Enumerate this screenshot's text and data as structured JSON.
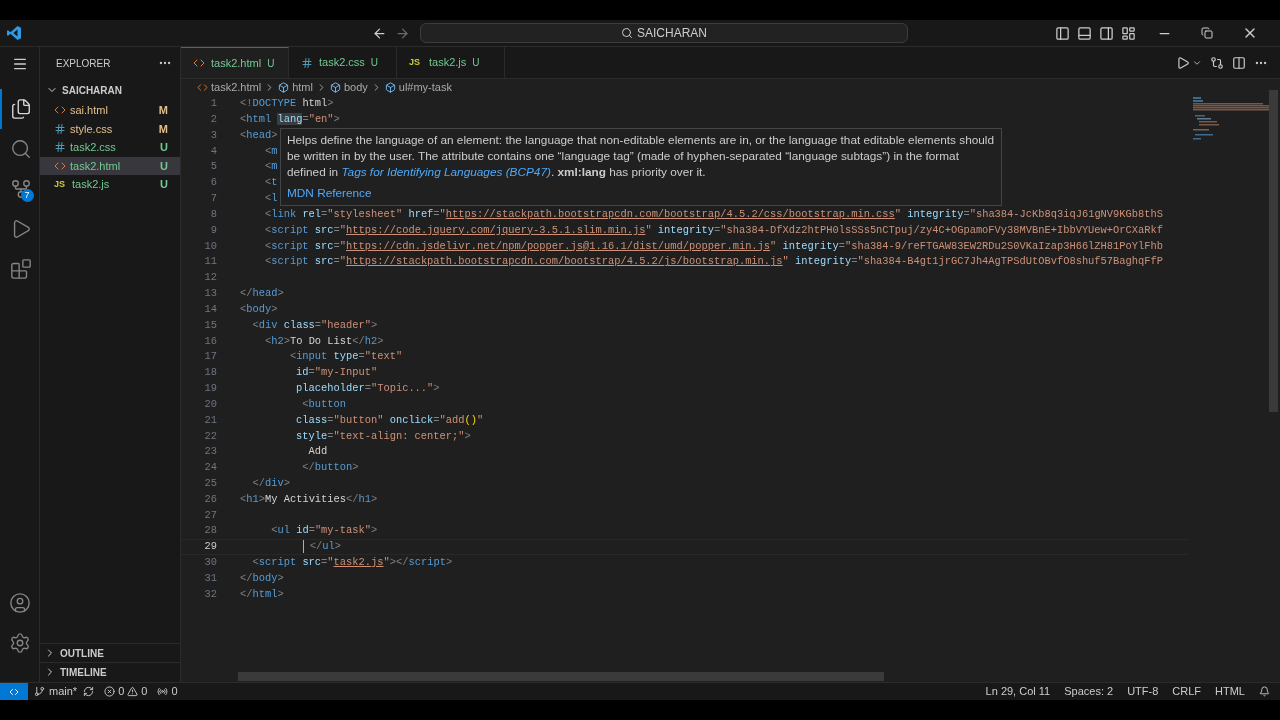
{
  "title_bar": {
    "search_text": "SAICHARAN"
  },
  "activity_bar": [
    {
      "kind": "explorer",
      "selected": true
    },
    {
      "kind": "search",
      "selected": false
    },
    {
      "kind": "source_control",
      "selected": false,
      "badge": "7"
    },
    {
      "kind": "run",
      "selected": false
    },
    {
      "kind": "extensions",
      "selected": false
    }
  ],
  "explorer": {
    "title": "EXPLORER",
    "folder": {
      "name": "SAICHARAN",
      "expanded": true,
      "children": [
        {
          "name": "sai.html",
          "kind": "html",
          "status": "M",
          "color": "#e2c08d",
          "selected": false
        },
        {
          "name": "style.css",
          "kind": "css",
          "status": "M",
          "color": "#e2c08d",
          "selected": false
        },
        {
          "name": "task2.css",
          "kind": "css",
          "status": "U",
          "color": "#73c991",
          "selected": false
        },
        {
          "name": "task2.html",
          "kind": "html",
          "status": "U",
          "color": "#73c991",
          "selected": true
        },
        {
          "name": "task2.js",
          "kind": "js",
          "icon_label": "JS",
          "status": "U",
          "color": "#73c991",
          "selected": false
        }
      ]
    },
    "sections": [
      {
        "label": "OUTLINE",
        "expanded": false
      },
      {
        "label": "TIMELINE",
        "expanded": false
      }
    ]
  },
  "tabs": [
    {
      "label": "task2.html",
      "kind": "html",
      "status": "U",
      "color": "#73c991",
      "selected": true
    },
    {
      "label": "task2.css",
      "kind": "css",
      "status": "U",
      "color": "#73c991",
      "selected": false
    },
    {
      "label": "task2.js",
      "kind": "js",
      "icon_label": "JS",
      "status": "U",
      "color": "#73c991",
      "selected": false
    }
  ],
  "breadcrumb": [
    {
      "label": "task2.html",
      "kind": "file"
    },
    {
      "label": "html",
      "kind": "element"
    },
    {
      "label": "body",
      "kind": "element"
    },
    {
      "label": "ul#my-task",
      "kind": "element"
    }
  ],
  "editor": {
    "lines": [
      {
        "number": "1",
        "active": false,
        "tokens": [
          {
            "kind": "punct",
            "text": "<!"
          },
          {
            "kind": "tag",
            "text": "DOCTYPE"
          },
          {
            "kind": "plain",
            "text": " html"
          },
          {
            "kind": "punct",
            "text": ">"
          }
        ]
      },
      {
        "number": "2",
        "active": false,
        "tokens": [
          {
            "kind": "punct",
            "text": "<"
          },
          {
            "kind": "tag",
            "text": "html "
          },
          {
            "kind": "attr",
            "text": "lang",
            "highlighted": true
          },
          {
            "kind": "punct",
            "text": "="
          },
          {
            "kind": "string",
            "text": "\"en\""
          },
          {
            "kind": "punct",
            "text": ">"
          }
        ]
      },
      {
        "number": "3",
        "active": false,
        "tokens": [
          {
            "kind": "punct",
            "text": "<"
          },
          {
            "kind": "tag",
            "text": "head"
          },
          {
            "kind": "punct",
            "text": ">"
          }
        ]
      },
      {
        "number": "4",
        "active": false,
        "tokens": [
          {
            "kind": "punct",
            "text": "    <"
          },
          {
            "kind": "tag",
            "text": "m"
          }
        ]
      },
      {
        "number": "5",
        "active": false,
        "tokens": [
          {
            "kind": "punct",
            "text": "    <"
          },
          {
            "kind": "tag",
            "text": "m"
          }
        ]
      },
      {
        "number": "6",
        "active": false,
        "tokens": [
          {
            "kind": "punct",
            "text": "    <"
          },
          {
            "kind": "tag",
            "text": "t"
          }
        ]
      },
      {
        "number": "7",
        "active": false,
        "tokens": [
          {
            "kind": "punct",
            "text": "    <"
          },
          {
            "kind": "tag",
            "text": "l"
          }
        ]
      },
      {
        "number": "8",
        "active": false,
        "tokens": [
          {
            "kind": "punct",
            "text": "    <"
          },
          {
            "kind": "tag",
            "text": "link"
          },
          {
            "kind": "attr",
            "text": " rel"
          },
          {
            "kind": "punct",
            "text": "="
          },
          {
            "kind": "string",
            "text": "\"stylesheet\""
          },
          {
            "kind": "attr",
            "text": " href"
          },
          {
            "kind": "punct",
            "text": "="
          },
          {
            "kind": "string",
            "text": "\""
          },
          {
            "kind": "url",
            "text": "https://stackpath.bootstrapcdn.com/bootstrap/4.5.2/css/bootstrap.min.css"
          },
          {
            "kind": "string",
            "text": "\""
          },
          {
            "kind": "attr",
            "text": " integrity"
          },
          {
            "kind": "punct",
            "text": "="
          },
          {
            "kind": "string",
            "text": "\"sha384-JcKb8q3iqJ61gNV9KGb8thS"
          }
        ]
      },
      {
        "number": "9",
        "active": false,
        "tokens": [
          {
            "kind": "punct",
            "text": "    <"
          },
          {
            "kind": "tag",
            "text": "script"
          },
          {
            "kind": "attr",
            "text": " src"
          },
          {
            "kind": "punct",
            "text": "="
          },
          {
            "kind": "string",
            "text": "\""
          },
          {
            "kind": "url",
            "text": "https://code.jquery.com/jquery-3.5.1.slim.min.js"
          },
          {
            "kind": "string",
            "text": "\""
          },
          {
            "kind": "attr",
            "text": " integrity"
          },
          {
            "kind": "punct",
            "text": "="
          },
          {
            "kind": "string",
            "text": "\"sha384-DfXdz2htPH0lsSSs5nCTpuj/zy4C+OGpamoFVy38MVBnE+IbbVYUew+OrCXaRkf"
          }
        ]
      },
      {
        "number": "10",
        "active": false,
        "tokens": [
          {
            "kind": "punct",
            "text": "    <"
          },
          {
            "kind": "tag",
            "text": "script"
          },
          {
            "kind": "attr",
            "text": " src"
          },
          {
            "kind": "punct",
            "text": "="
          },
          {
            "kind": "string",
            "text": "\""
          },
          {
            "kind": "url",
            "text": "https://cdn.jsdelivr.net/npm/popper.js@1.16.1/dist/umd/popper.min.js"
          },
          {
            "kind": "string",
            "text": "\""
          },
          {
            "kind": "attr",
            "text": " integrity"
          },
          {
            "kind": "punct",
            "text": "="
          },
          {
            "kind": "string",
            "text": "\"sha384-9/reFTGAW83EW2RDu2S0VKaIzap3H66lZH81PoYlFhb"
          }
        ]
      },
      {
        "number": "11",
        "active": false,
        "tokens": [
          {
            "kind": "punct",
            "text": "    <"
          },
          {
            "kind": "tag",
            "text": "script"
          },
          {
            "kind": "attr",
            "text": " src"
          },
          {
            "kind": "punct",
            "text": "="
          },
          {
            "kind": "string",
            "text": "\""
          },
          {
            "kind": "url",
            "text": "https://stackpath.bootstrapcdn.com/bootstrap/4.5.2/js/bootstrap.min.js"
          },
          {
            "kind": "string",
            "text": "\""
          },
          {
            "kind": "attr",
            "text": " integrity"
          },
          {
            "kind": "punct",
            "text": "="
          },
          {
            "kind": "string",
            "text": "\"sha384-B4gt1jrGC7Jh4AgTPSdUtOBvfO8shuf57BaghqFfP"
          }
        ]
      },
      {
        "number": "12",
        "active": false
      },
      {
        "number": "13",
        "active": false,
        "tokens": [
          {
            "kind": "punct",
            "text": "</"
          },
          {
            "kind": "tag",
            "text": "head"
          },
          {
            "kind": "punct",
            "text": ">"
          }
        ]
      },
      {
        "number": "14",
        "active": false,
        "tokens": [
          {
            "kind": "punct",
            "text": "<"
          },
          {
            "kind": "tag",
            "text": "body"
          },
          {
            "kind": "punct",
            "text": ">"
          }
        ]
      },
      {
        "number": "15",
        "active": false,
        "tokens": [
          {
            "kind": "punct",
            "text": "  <"
          },
          {
            "kind": "tag",
            "text": "div"
          },
          {
            "kind": "attr",
            "text": " class"
          },
          {
            "kind": "punct",
            "text": "="
          },
          {
            "kind": "string",
            "text": "\"header\""
          },
          {
            "kind": "punct",
            "text": ">"
          }
        ]
      },
      {
        "number": "16",
        "active": false,
        "tokens": [
          {
            "kind": "punct",
            "text": "    <"
          },
          {
            "kind": "tag",
            "text": "h2"
          },
          {
            "kind": "punct",
            "text": ">"
          },
          {
            "kind": "plain",
            "text": "To Do List"
          },
          {
            "kind": "punct",
            "text": "</"
          },
          {
            "kind": "tag",
            "text": "h2"
          },
          {
            "kind": "punct",
            "text": ">"
          }
        ]
      },
      {
        "number": "17",
        "active": false,
        "tokens": [
          {
            "kind": "punct",
            "text": "        <"
          },
          {
            "kind": "tag",
            "text": "input"
          },
          {
            "kind": "attr",
            "text": " type"
          },
          {
            "kind": "punct",
            "text": "="
          },
          {
            "kind": "string",
            "text": "\"text\""
          }
        ]
      },
      {
        "number": "18",
        "active": false,
        "tokens": [
          {
            "kind": "attr",
            "text": "         id"
          },
          {
            "kind": "punct",
            "text": "="
          },
          {
            "kind": "string",
            "text": "\"my-Input\""
          }
        ]
      },
      {
        "number": "19",
        "active": false,
        "tokens": [
          {
            "kind": "attr",
            "text": "         placeholder"
          },
          {
            "kind": "punct",
            "text": "="
          },
          {
            "kind": "string",
            "text": "\"Topic...\""
          },
          {
            "kind": "punct",
            "text": ">"
          }
        ]
      },
      {
        "number": "20",
        "active": false,
        "tokens": [
          {
            "kind": "punct",
            "text": "          <"
          },
          {
            "kind": "tag",
            "text": "button"
          }
        ]
      },
      {
        "number": "21",
        "active": false,
        "tokens": [
          {
            "kind": "attr",
            "text": "         class"
          },
          {
            "kind": "punct",
            "text": "="
          },
          {
            "kind": "string",
            "text": "\"button\""
          },
          {
            "kind": "attr",
            "text": " onclick"
          },
          {
            "kind": "punct",
            "text": "="
          },
          {
            "kind": "string",
            "text": "\"add"
          },
          {
            "kind": "bracket",
            "text": "()"
          },
          {
            "kind": "string",
            "text": "\""
          }
        ]
      },
      {
        "number": "22",
        "active": false,
        "tokens": [
          {
            "kind": "attr",
            "text": "         style"
          },
          {
            "kind": "punct",
            "text": "="
          },
          {
            "kind": "string",
            "text": "\"text-align: center;\""
          },
          {
            "kind": "punct",
            "text": ">"
          }
        ]
      },
      {
        "number": "23",
        "active": false,
        "tokens": [
          {
            "kind": "plain",
            "text": "           Add"
          }
        ]
      },
      {
        "number": "24",
        "active": false,
        "tokens": [
          {
            "kind": "punct",
            "text": "          </"
          },
          {
            "kind": "tag",
            "text": "button"
          },
          {
            "kind": "punct",
            "text": ">"
          }
        ]
      },
      {
        "number": "25",
        "active": false,
        "tokens": [
          {
            "kind": "punct",
            "text": "  </"
          },
          {
            "kind": "tag",
            "text": "div"
          },
          {
            "kind": "punct",
            "text": ">"
          }
        ]
      },
      {
        "number": "26",
        "active": false,
        "tokens": [
          {
            "kind": "punct",
            "text": "<"
          },
          {
            "kind": "tag",
            "text": "h1"
          },
          {
            "kind": "punct",
            "text": ">"
          },
          {
            "kind": "plain",
            "text": "My Activities"
          },
          {
            "kind": "punct",
            "text": "</"
          },
          {
            "kind": "tag",
            "text": "h1"
          },
          {
            "kind": "punct",
            "text": ">"
          }
        ]
      },
      {
        "number": "27",
        "active": false
      },
      {
        "number": "28",
        "active": false,
        "tokens": [
          {
            "kind": "punct",
            "text": "     <"
          },
          {
            "kind": "tag",
            "text": "ul"
          },
          {
            "kind": "attr",
            "text": " id"
          },
          {
            "kind": "punct",
            "text": "="
          },
          {
            "kind": "string",
            "text": "\"my-task\""
          },
          {
            "kind": "punct",
            "text": ">"
          }
        ]
      },
      {
        "number": "29",
        "active": true,
        "tokens": [
          {
            "kind": "cursor"
          },
          {
            "kind": "punct",
            "text": " </"
          },
          {
            "kind": "tag",
            "text": "ul"
          },
          {
            "kind": "punct",
            "text": ">"
          }
        ]
      },
      {
        "number": "30",
        "active": false,
        "tokens": [
          {
            "kind": "punct",
            "text": "  <"
          },
          {
            "kind": "tag",
            "text": "script"
          },
          {
            "kind": "attr",
            "text": " src"
          },
          {
            "kind": "punct",
            "text": "="
          },
          {
            "kind": "string",
            "text": "\""
          },
          {
            "kind": "url",
            "text": "task2.js"
          },
          {
            "kind": "string",
            "text": "\""
          },
          {
            "kind": "punct",
            "text": "></"
          },
          {
            "kind": "tag",
            "text": "script"
          },
          {
            "kind": "punct",
            "text": ">"
          }
        ]
      },
      {
        "number": "31",
        "active": false,
        "tokens": [
          {
            "kind": "punct",
            "text": "</"
          },
          {
            "kind": "tag",
            "text": "body"
          },
          {
            "kind": "punct",
            "text": ">"
          }
        ]
      },
      {
        "number": "32",
        "active": false,
        "tokens": [
          {
            "kind": "punct",
            "text": "</"
          },
          {
            "kind": "tag",
            "text": "html"
          },
          {
            "kind": "punct",
            "text": ">"
          }
        ]
      }
    ],
    "hover": {
      "description": {
        "before": "Helps define the language of an element: the language that non-editable elements are in, or the language that editable elements should be written in by the user. The attribute contains one “language tag” (made of hyphen-separated “language subtags”) in the format defined in ",
        "link": "Tags for Identifying Languages (BCP47)",
        "after": ". **xml:lang** has priority over it."
      },
      "reference": "MDN Reference"
    }
  },
  "status_bar": {
    "branch": "main*",
    "errors": "0",
    "warnings": "0",
    "ports": "0",
    "right": [
      "Ln 29, Col 11",
      "Spaces: 2",
      "UTF-8",
      "CRLF",
      "HTML"
    ]
  }
}
